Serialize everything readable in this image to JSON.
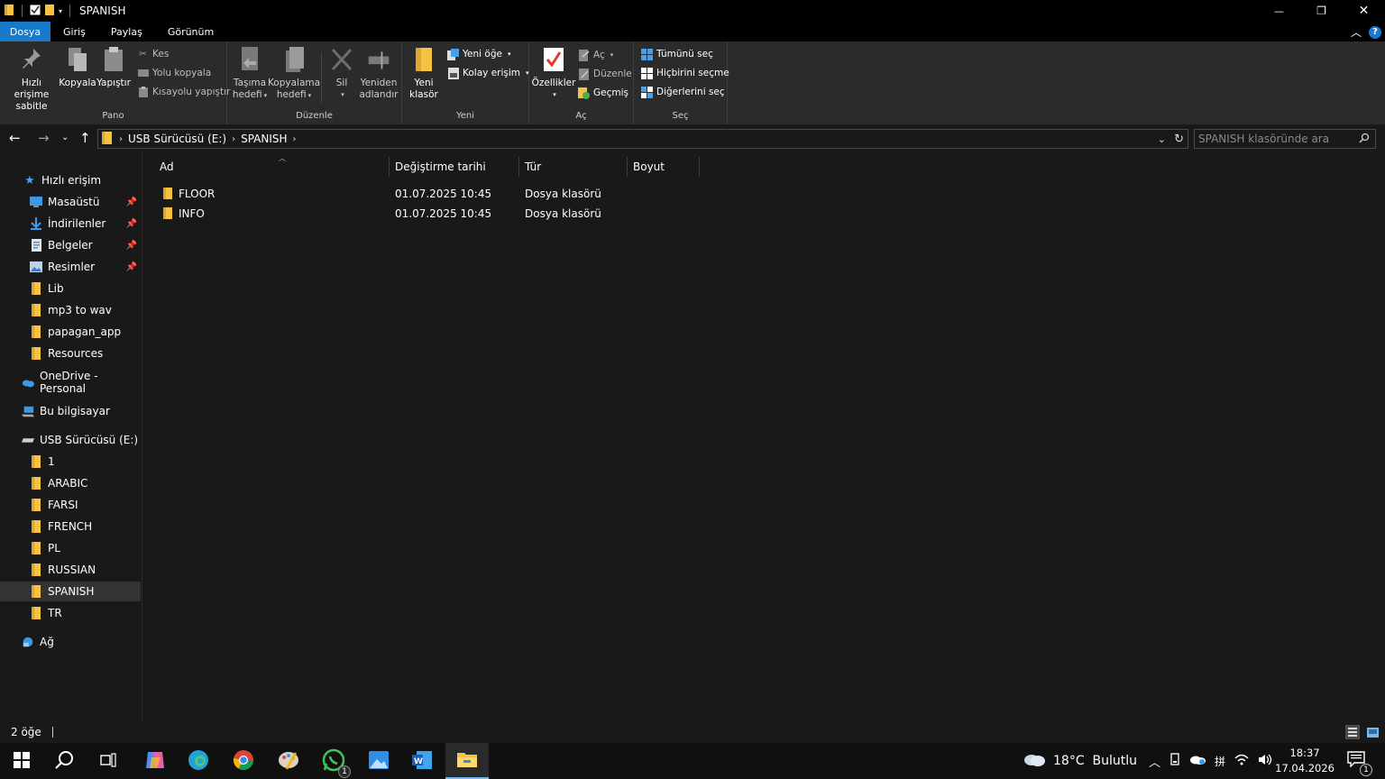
{
  "window": {
    "title": "SPANISH",
    "controls": {
      "minimize": "—",
      "maximize": "❐",
      "close": "✕"
    }
  },
  "menu_tabs": [
    "Dosya",
    "Giriş",
    "Paylaş",
    "Görünüm"
  ],
  "ribbon": {
    "pano": {
      "label": "Pano",
      "pin": [
        "Hızlı erişime",
        "sabitle"
      ],
      "copy": "Kopyala",
      "paste": "Yapıştır",
      "cut": "Kes",
      "copy_path": "Yolu kopyala",
      "paste_shortcut": "Kısayolu yapıştır"
    },
    "duzenle": {
      "label": "Düzenle",
      "move_to": [
        "Taşıma",
        "hedefi"
      ],
      "copy_to": [
        "Kopyalama",
        "hedefi"
      ],
      "delete": "Sil",
      "rename": [
        "Yeniden",
        "adlandır"
      ]
    },
    "yeni": {
      "label": "Yeni",
      "new_folder": [
        "Yeni",
        "klasör"
      ],
      "new_item": "Yeni öğe",
      "easy_access": "Kolay erişim"
    },
    "ac": {
      "label": "Aç",
      "properties": "Özellikler",
      "open": "Aç",
      "edit": "Düzenle",
      "history": "Geçmiş"
    },
    "sec": {
      "label": "Seç",
      "select_all": "Tümünü seç",
      "select_none": "Hiçbirini seçme",
      "invert": "Diğerlerini seç"
    }
  },
  "address": {
    "crumbs": [
      "USB Sürücüsü (E:)",
      "SPANISH"
    ],
    "search_placeholder": "SPANISH klasöründe ara"
  },
  "sidebar": {
    "quick_access": "Hızlı erişim",
    "quick_items": [
      {
        "label": "Masaüstü",
        "icon": "desktop-icon",
        "pinned": true
      },
      {
        "label": "İndirilenler",
        "icon": "download-icon",
        "pinned": true
      },
      {
        "label": "Belgeler",
        "icon": "documents-icon",
        "pinned": true
      },
      {
        "label": "Resimler",
        "icon": "pictures-icon",
        "pinned": true
      },
      {
        "label": "Lib",
        "icon": "folder-icon",
        "pinned": false
      },
      {
        "label": "mp3 to wav",
        "icon": "folder-icon",
        "pinned": false
      },
      {
        "label": "papagan_app",
        "icon": "folder-icon",
        "pinned": false
      },
      {
        "label": "Resources",
        "icon": "folder-icon",
        "pinned": false
      }
    ],
    "onedrive": "OneDrive - Personal",
    "this_pc": "Bu bilgisayar",
    "usb": "USB Sürücüsü (E:)",
    "usb_items": [
      "1",
      "ARABIC",
      "FARSI",
      "FRENCH",
      "PL",
      "RUSSIAN",
      "SPANISH",
      "TR"
    ],
    "selected": "SPANISH",
    "network": "Ağ"
  },
  "file_list": {
    "columns": [
      "Ad",
      "Değiştirme tarihi",
      "Tür",
      "Boyut"
    ],
    "rows": [
      {
        "name": "FLOOR",
        "modified": "01.07.2025 10:45",
        "type": "Dosya klasörü",
        "size": ""
      },
      {
        "name": "INFO",
        "modified": "01.07.2025 10:45",
        "type": "Dosya klasörü",
        "size": ""
      }
    ]
  },
  "status": {
    "count": "2 öğe"
  },
  "taskbar": {
    "apps": [
      "start-icon",
      "search-icon",
      "task-view-icon",
      "copilot-icon",
      "edge-icon",
      "chrome-icon",
      "paint-icon",
      "whatsapp-icon",
      "photos-icon",
      "word-icon",
      "file-explorer-icon"
    ],
    "whatsapp_badge": "1",
    "weather": "18°C  Bulutlu",
    "time": "18:37",
    "date": "17.04.2026",
    "notification_badge": "1"
  },
  "colors": {
    "accent": "#1979ca",
    "folder": "#f5c242",
    "background": "#191919",
    "ribbon": "#2b2b2b"
  }
}
